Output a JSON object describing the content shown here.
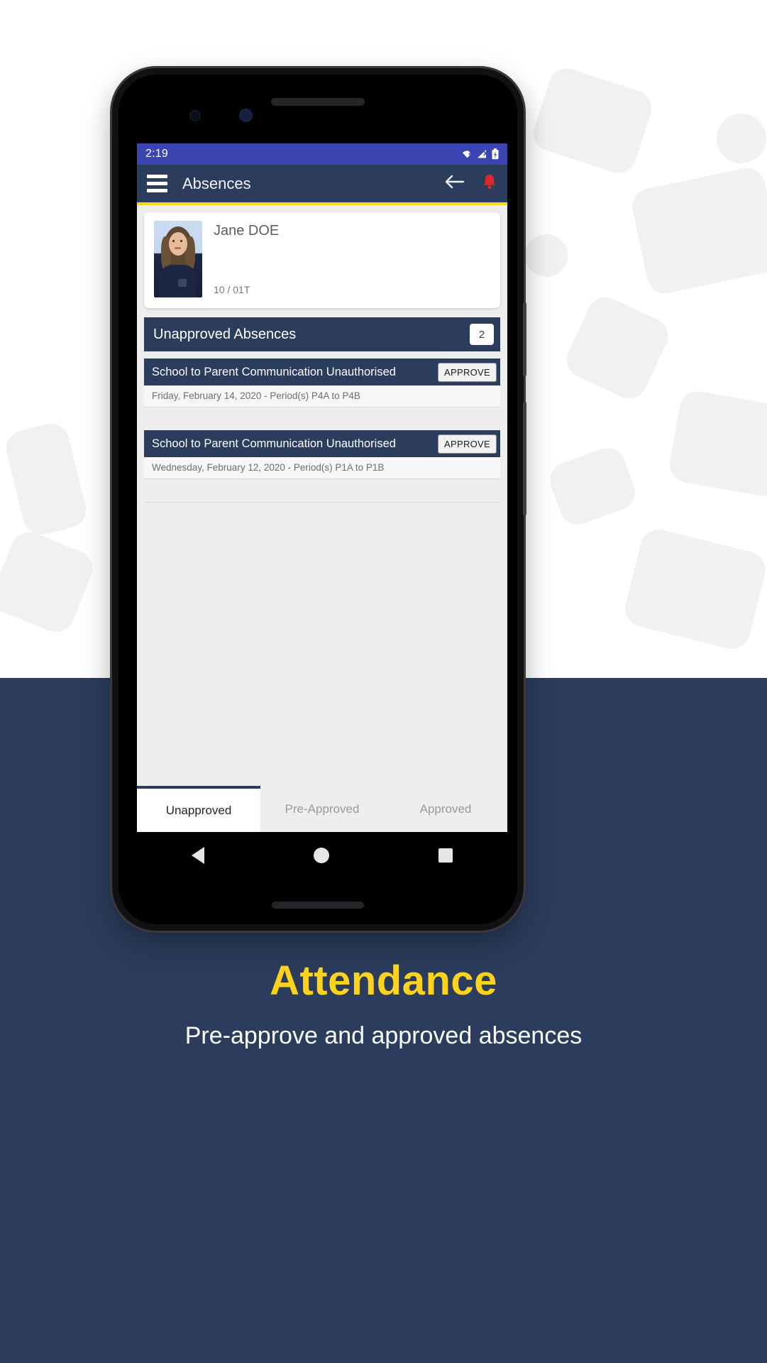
{
  "promo": {
    "headline": "Attendance",
    "subhead": "Pre-approve and approved absences",
    "headline_color": "#ffd21e",
    "background_color": "#2b3c5c"
  },
  "status_bar": {
    "time": "2:19",
    "icons": [
      "wifi-off-icon",
      "signal-off-icon",
      "battery-icon"
    ]
  },
  "app_bar": {
    "menu_icon": "hamburger-menu-icon",
    "title": "Absences",
    "back_icon": "back-arrow-icon",
    "notification_icon": "bell-icon",
    "background_color": "#2b3c5c",
    "accent_color": "#ffd21e"
  },
  "student": {
    "name": "Jane DOE",
    "class": "10 / 01T",
    "photo_alt": "student-photo"
  },
  "section": {
    "title": "Unapproved Absences",
    "count": "2"
  },
  "absences": [
    {
      "reason": "School to Parent Communication Unauthorised",
      "action_label": "APPROVE",
      "date": "Friday, February 14, 2020 - Period(s) P4A to P4B"
    },
    {
      "reason": "School to Parent Communication Unauthorised",
      "action_label": "APPROVE",
      "date": "Wednesday, February 12, 2020 - Period(s) P1A to P1B"
    }
  ],
  "tabs": [
    {
      "label": "Unapproved",
      "active": true
    },
    {
      "label": "Pre-Approved",
      "active": false
    },
    {
      "label": "Approved",
      "active": false
    }
  ],
  "nav_bar": {
    "back": "nav-back-icon",
    "home": "nav-home-icon",
    "recents": "nav-recents-icon"
  }
}
